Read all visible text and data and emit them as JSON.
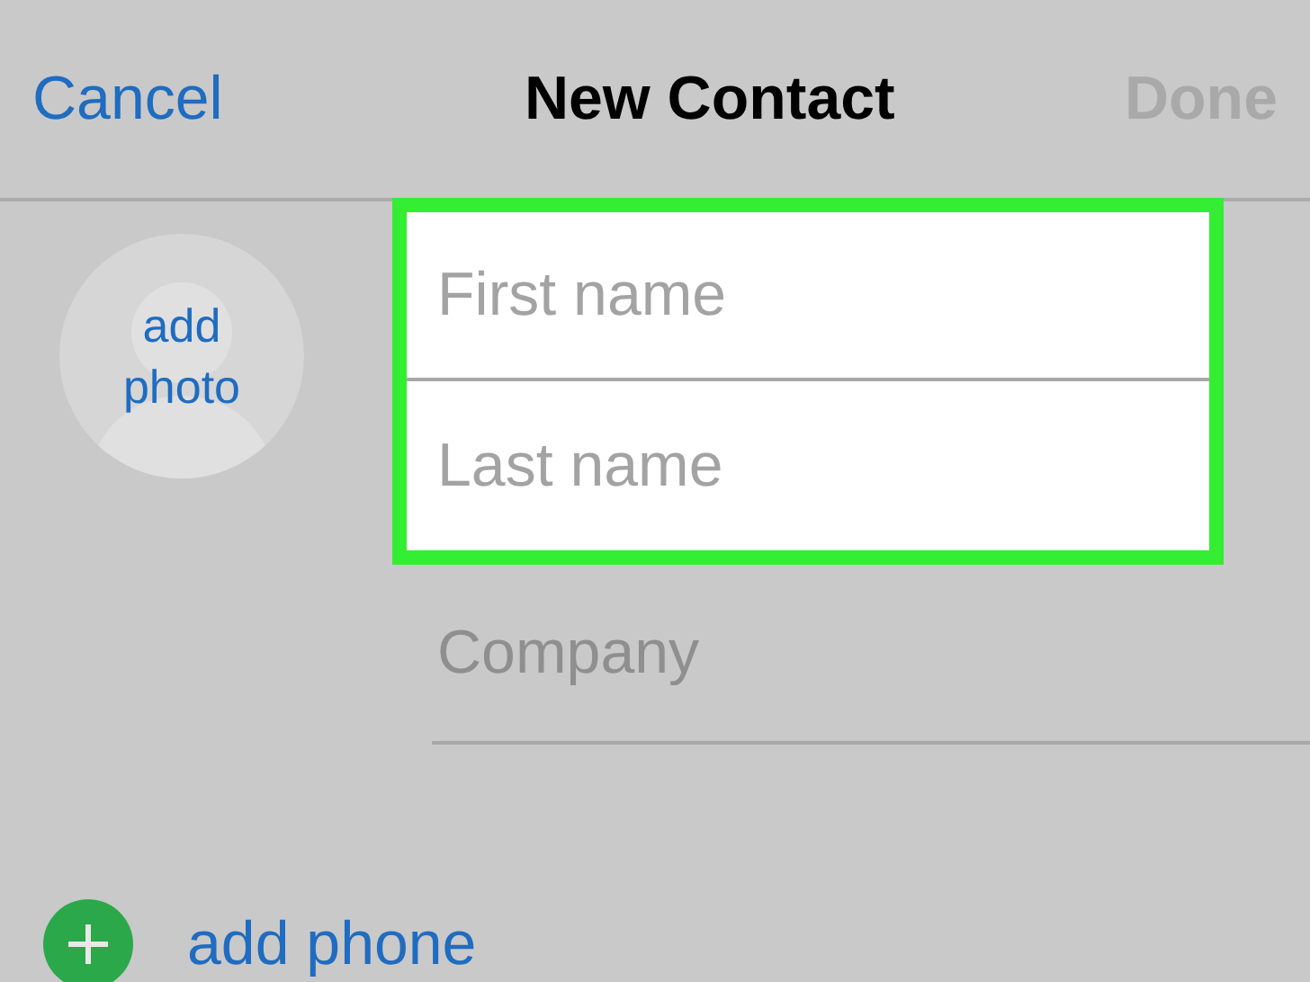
{
  "nav": {
    "cancel": "Cancel",
    "title": "New Contact",
    "done": {
      "label": "Done",
      "disabled": true
    }
  },
  "photo": {
    "label": "add photo"
  },
  "highlighted_fields": [
    {
      "placeholder": "First name"
    },
    {
      "placeholder": "Last name"
    }
  ],
  "fields": [
    {
      "placeholder": "Company"
    }
  ],
  "add_phone": "add phone"
}
